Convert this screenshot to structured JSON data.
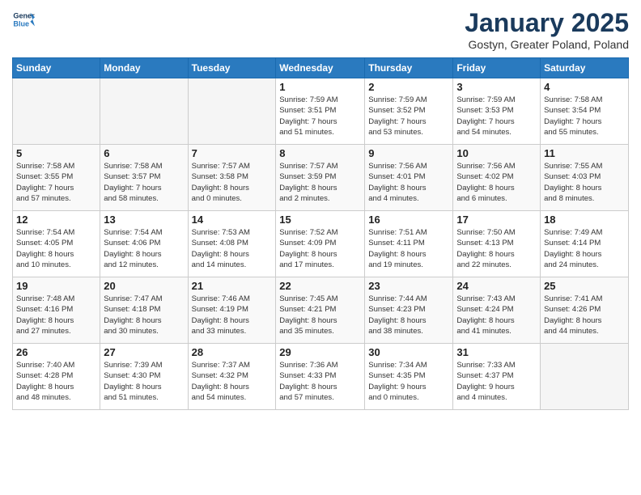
{
  "logo": {
    "line1": "General",
    "line2": "Blue"
  },
  "title": "January 2025",
  "subtitle": "Gostyn, Greater Poland, Poland",
  "days_of_week": [
    "Sunday",
    "Monday",
    "Tuesday",
    "Wednesday",
    "Thursday",
    "Friday",
    "Saturday"
  ],
  "weeks": [
    [
      {
        "day": "",
        "info": ""
      },
      {
        "day": "",
        "info": ""
      },
      {
        "day": "",
        "info": ""
      },
      {
        "day": "1",
        "info": "Sunrise: 7:59 AM\nSunset: 3:51 PM\nDaylight: 7 hours\nand 51 minutes."
      },
      {
        "day": "2",
        "info": "Sunrise: 7:59 AM\nSunset: 3:52 PM\nDaylight: 7 hours\nand 53 minutes."
      },
      {
        "day": "3",
        "info": "Sunrise: 7:59 AM\nSunset: 3:53 PM\nDaylight: 7 hours\nand 54 minutes."
      },
      {
        "day": "4",
        "info": "Sunrise: 7:58 AM\nSunset: 3:54 PM\nDaylight: 7 hours\nand 55 minutes."
      }
    ],
    [
      {
        "day": "5",
        "info": "Sunrise: 7:58 AM\nSunset: 3:55 PM\nDaylight: 7 hours\nand 57 minutes."
      },
      {
        "day": "6",
        "info": "Sunrise: 7:58 AM\nSunset: 3:57 PM\nDaylight: 7 hours\nand 58 minutes."
      },
      {
        "day": "7",
        "info": "Sunrise: 7:57 AM\nSunset: 3:58 PM\nDaylight: 8 hours\nand 0 minutes."
      },
      {
        "day": "8",
        "info": "Sunrise: 7:57 AM\nSunset: 3:59 PM\nDaylight: 8 hours\nand 2 minutes."
      },
      {
        "day": "9",
        "info": "Sunrise: 7:56 AM\nSunset: 4:01 PM\nDaylight: 8 hours\nand 4 minutes."
      },
      {
        "day": "10",
        "info": "Sunrise: 7:56 AM\nSunset: 4:02 PM\nDaylight: 8 hours\nand 6 minutes."
      },
      {
        "day": "11",
        "info": "Sunrise: 7:55 AM\nSunset: 4:03 PM\nDaylight: 8 hours\nand 8 minutes."
      }
    ],
    [
      {
        "day": "12",
        "info": "Sunrise: 7:54 AM\nSunset: 4:05 PM\nDaylight: 8 hours\nand 10 minutes."
      },
      {
        "day": "13",
        "info": "Sunrise: 7:54 AM\nSunset: 4:06 PM\nDaylight: 8 hours\nand 12 minutes."
      },
      {
        "day": "14",
        "info": "Sunrise: 7:53 AM\nSunset: 4:08 PM\nDaylight: 8 hours\nand 14 minutes."
      },
      {
        "day": "15",
        "info": "Sunrise: 7:52 AM\nSunset: 4:09 PM\nDaylight: 8 hours\nand 17 minutes."
      },
      {
        "day": "16",
        "info": "Sunrise: 7:51 AM\nSunset: 4:11 PM\nDaylight: 8 hours\nand 19 minutes."
      },
      {
        "day": "17",
        "info": "Sunrise: 7:50 AM\nSunset: 4:13 PM\nDaylight: 8 hours\nand 22 minutes."
      },
      {
        "day": "18",
        "info": "Sunrise: 7:49 AM\nSunset: 4:14 PM\nDaylight: 8 hours\nand 24 minutes."
      }
    ],
    [
      {
        "day": "19",
        "info": "Sunrise: 7:48 AM\nSunset: 4:16 PM\nDaylight: 8 hours\nand 27 minutes."
      },
      {
        "day": "20",
        "info": "Sunrise: 7:47 AM\nSunset: 4:18 PM\nDaylight: 8 hours\nand 30 minutes."
      },
      {
        "day": "21",
        "info": "Sunrise: 7:46 AM\nSunset: 4:19 PM\nDaylight: 8 hours\nand 33 minutes."
      },
      {
        "day": "22",
        "info": "Sunrise: 7:45 AM\nSunset: 4:21 PM\nDaylight: 8 hours\nand 35 minutes."
      },
      {
        "day": "23",
        "info": "Sunrise: 7:44 AM\nSunset: 4:23 PM\nDaylight: 8 hours\nand 38 minutes."
      },
      {
        "day": "24",
        "info": "Sunrise: 7:43 AM\nSunset: 4:24 PM\nDaylight: 8 hours\nand 41 minutes."
      },
      {
        "day": "25",
        "info": "Sunrise: 7:41 AM\nSunset: 4:26 PM\nDaylight: 8 hours\nand 44 minutes."
      }
    ],
    [
      {
        "day": "26",
        "info": "Sunrise: 7:40 AM\nSunset: 4:28 PM\nDaylight: 8 hours\nand 48 minutes."
      },
      {
        "day": "27",
        "info": "Sunrise: 7:39 AM\nSunset: 4:30 PM\nDaylight: 8 hours\nand 51 minutes."
      },
      {
        "day": "28",
        "info": "Sunrise: 7:37 AM\nSunset: 4:32 PM\nDaylight: 8 hours\nand 54 minutes."
      },
      {
        "day": "29",
        "info": "Sunrise: 7:36 AM\nSunset: 4:33 PM\nDaylight: 8 hours\nand 57 minutes."
      },
      {
        "day": "30",
        "info": "Sunrise: 7:34 AM\nSunset: 4:35 PM\nDaylight: 9 hours\nand 0 minutes."
      },
      {
        "day": "31",
        "info": "Sunrise: 7:33 AM\nSunset: 4:37 PM\nDaylight: 9 hours\nand 4 minutes."
      },
      {
        "day": "",
        "info": ""
      }
    ]
  ]
}
